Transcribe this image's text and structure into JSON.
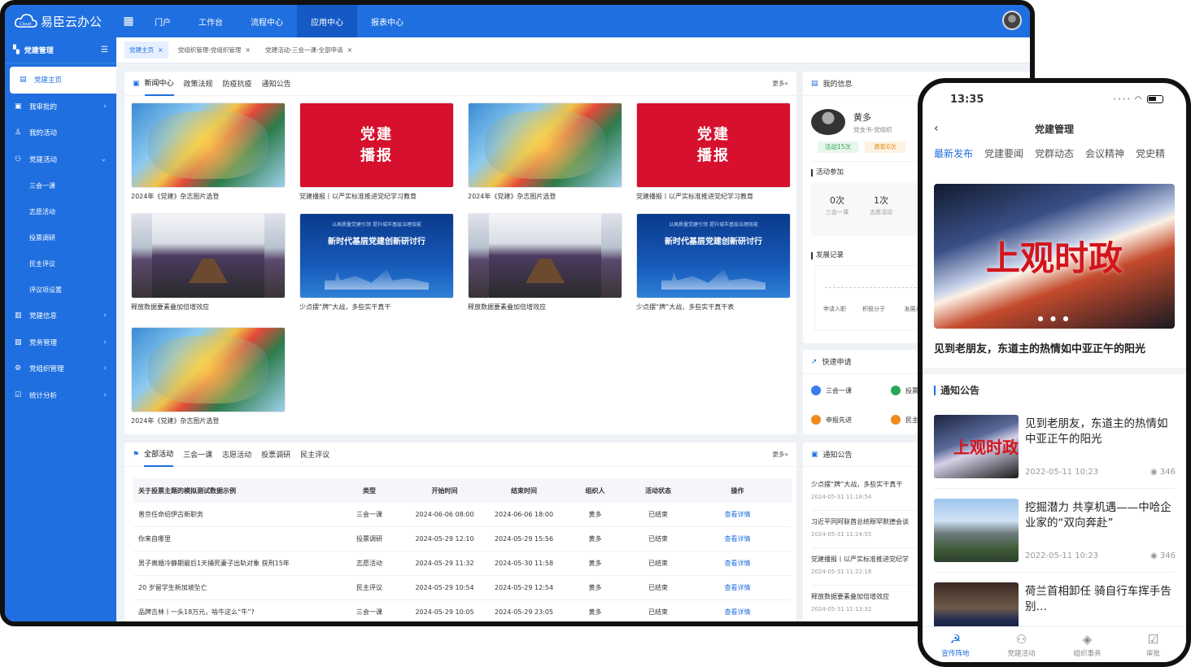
{
  "app": {
    "name": "易臣云办公",
    "logo_text": "Cloud",
    "top_nav": [
      "门户",
      "工作台",
      "流程中心",
      "应用中心",
      "报表中心"
    ],
    "top_nav_active": 3
  },
  "sidebar": {
    "header": "党建管理",
    "items": [
      {
        "label": "党建主页",
        "icon": "document-icon",
        "active": true,
        "arrow": ""
      },
      {
        "label": "我审批的",
        "icon": "approval-icon",
        "arrow": "›"
      },
      {
        "label": "我的活动",
        "icon": "user-icon",
        "arrow": ""
      },
      {
        "label": "党建活动",
        "icon": "activity-icon",
        "arrow": "⌄"
      }
    ],
    "subitems": [
      "三会一课",
      "志愿活动",
      "投票调研",
      "民主评议",
      "评议项设置"
    ],
    "items2": [
      {
        "label": "党建信息",
        "icon": "info-icon",
        "arrow": "›"
      },
      {
        "label": "党务管理",
        "icon": "affairs-icon",
        "arrow": "›"
      },
      {
        "label": "党组织管理",
        "icon": "org-icon",
        "arrow": "›"
      },
      {
        "label": "统计分析",
        "icon": "stats-icon",
        "arrow": "›"
      }
    ]
  },
  "tabs": [
    {
      "label": "党建主页",
      "close": "×"
    },
    {
      "label": "党组织管理-党组织管理",
      "close": "×"
    },
    {
      "label": "党建活动-三会一课-全部申请",
      "close": "×"
    }
  ],
  "news_panel": {
    "tabs": [
      "新闻中心",
      "政策法规",
      "防疫抗疫",
      "通知公告"
    ],
    "more": "更多»",
    "red_banner": [
      "党建",
      "播报"
    ],
    "blue_banner_sub": "以高质量党建引领 提升城市基层治理效能",
    "blue_banner_title": "新时代基层党建创新研讨行",
    "cards": [
      {
        "caption": "2024年《党建》杂志图片选登",
        "img": "art"
      },
      {
        "caption": "党建播报丨以严实标准推进党纪学习教育",
        "img": "red"
      },
      {
        "caption": "2024年《党建》杂志图片选登",
        "img": "art"
      },
      {
        "caption": "党建播报丨以严实标准推进党纪学习教育",
        "img": "red"
      },
      {
        "caption": "释放数据要素叠加倍增效应",
        "img": "room"
      },
      {
        "caption": "少点摆“牌”大战，多些实干真干",
        "img": "blue"
      },
      {
        "caption": "释放数据要素叠加倍增效应",
        "img": "room"
      },
      {
        "caption": "少点摆“牌”大战，多些实干真干表",
        "img": "blue"
      },
      {
        "caption": "2024年《党建》杂志图片选登",
        "img": "art"
      }
    ]
  },
  "activity_panel": {
    "tabs": [
      "全部活动",
      "三会一课",
      "志愿活动",
      "投票调研",
      "民主评议"
    ],
    "more": "更多»",
    "headers": [
      "关于投票主题的模拟测试数据示例",
      "类型",
      "开始时间",
      "结束时间",
      "组织人",
      "活动状态",
      "操作"
    ],
    "rows": [
      [
        "普京任命绍伊古新职务",
        "三会一课",
        "2024-06-06 08:00",
        "2024-06-06 18:00",
        "黄多",
        "已结束",
        "查看详情"
      ],
      [
        "你来自哪里",
        "投票调研",
        "2024-05-29 12:10",
        "2024-05-29 15:56",
        "黄多",
        "已结束",
        "查看详情"
      ],
      [
        "男子离婚冷静期最后1天捅死妻子出轨对象 获刑15年",
        "志愿活动",
        "2024-05-29 11:32",
        "2024-05-30 11:58",
        "黄多",
        "已结束",
        "查看详情"
      ],
      [
        "20 岁留学生新加坡坠亡",
        "民主评议",
        "2024-05-29 10:54",
        "2024-05-29 12:54",
        "黄多",
        "已结束",
        "查看详情"
      ],
      [
        "品牌吉林丨一头18万元，啥牛这么“牛”?",
        "三会一课",
        "2024-05-29 10:05",
        "2024-05-29 23:05",
        "黄多",
        "已结束",
        "查看详情"
      ]
    ]
  },
  "my_info": {
    "title": "我的信息",
    "name": "黄多",
    "role": "党支书-党组织",
    "badges": [
      "活动15次",
      "表彰0次"
    ],
    "participation_title": "活动参加",
    "stats": [
      {
        "value": "0次",
        "label": "三会一课"
      },
      {
        "value": "1次",
        "label": "志愿活动"
      }
    ],
    "record_title": "发展记录",
    "record_steps": [
      "申请入职",
      "积极分子",
      "发展对"
    ]
  },
  "quick_apply": {
    "title": "快速申请",
    "items": [
      "三会一课",
      "投票",
      "申报先进",
      "民主"
    ]
  },
  "notice_panel": {
    "title": "通知公告",
    "items": [
      {
        "title": "少点摆“牌”大战，多些实干真干",
        "time": "2024-05-31 11:18:54"
      },
      {
        "title": "习近平同阿联酋总统穆罕默德会谈",
        "time": "2024-05-31 11:24:55"
      },
      {
        "title": "党建播报丨以严实标准推进党纪学",
        "time": "2024-05-31 11:22:18"
      },
      {
        "title": "释放数据要素叠加倍增效应",
        "time": "2024-05-31 11:13:32"
      }
    ]
  },
  "phone": {
    "time": "13:35",
    "title": "党建管理",
    "back": "‹",
    "tabs": [
      "最新发布",
      "党建要闻",
      "党群动态",
      "会议精神",
      "党史精"
    ],
    "hero_text": "上观时政",
    "hero_dots": "● ● ●",
    "hero_caption": "见到老朋友，东道主的热情如中亚正午的阳光",
    "section": "通知公告",
    "news": [
      {
        "title": "见到老朋友，东道主的热情如中亚正午的阳光",
        "date": "2022-05-11 10:23",
        "views": "◉ 346",
        "thumb_text": "上观时政"
      },
      {
        "title": "挖掘潜力 共享机遇——中哈企业家的“双向奔赴”",
        "date": "2022-05-11 10:23",
        "views": "◉ 346",
        "thumb_text": ""
      },
      {
        "title": "荷兰首相卸任 骑自行车挥手告别…",
        "date": "",
        "views": "",
        "thumb_text": ""
      }
    ],
    "bottom": [
      "宣传阵地",
      "党建活动",
      "组织事务",
      "审批"
    ]
  }
}
